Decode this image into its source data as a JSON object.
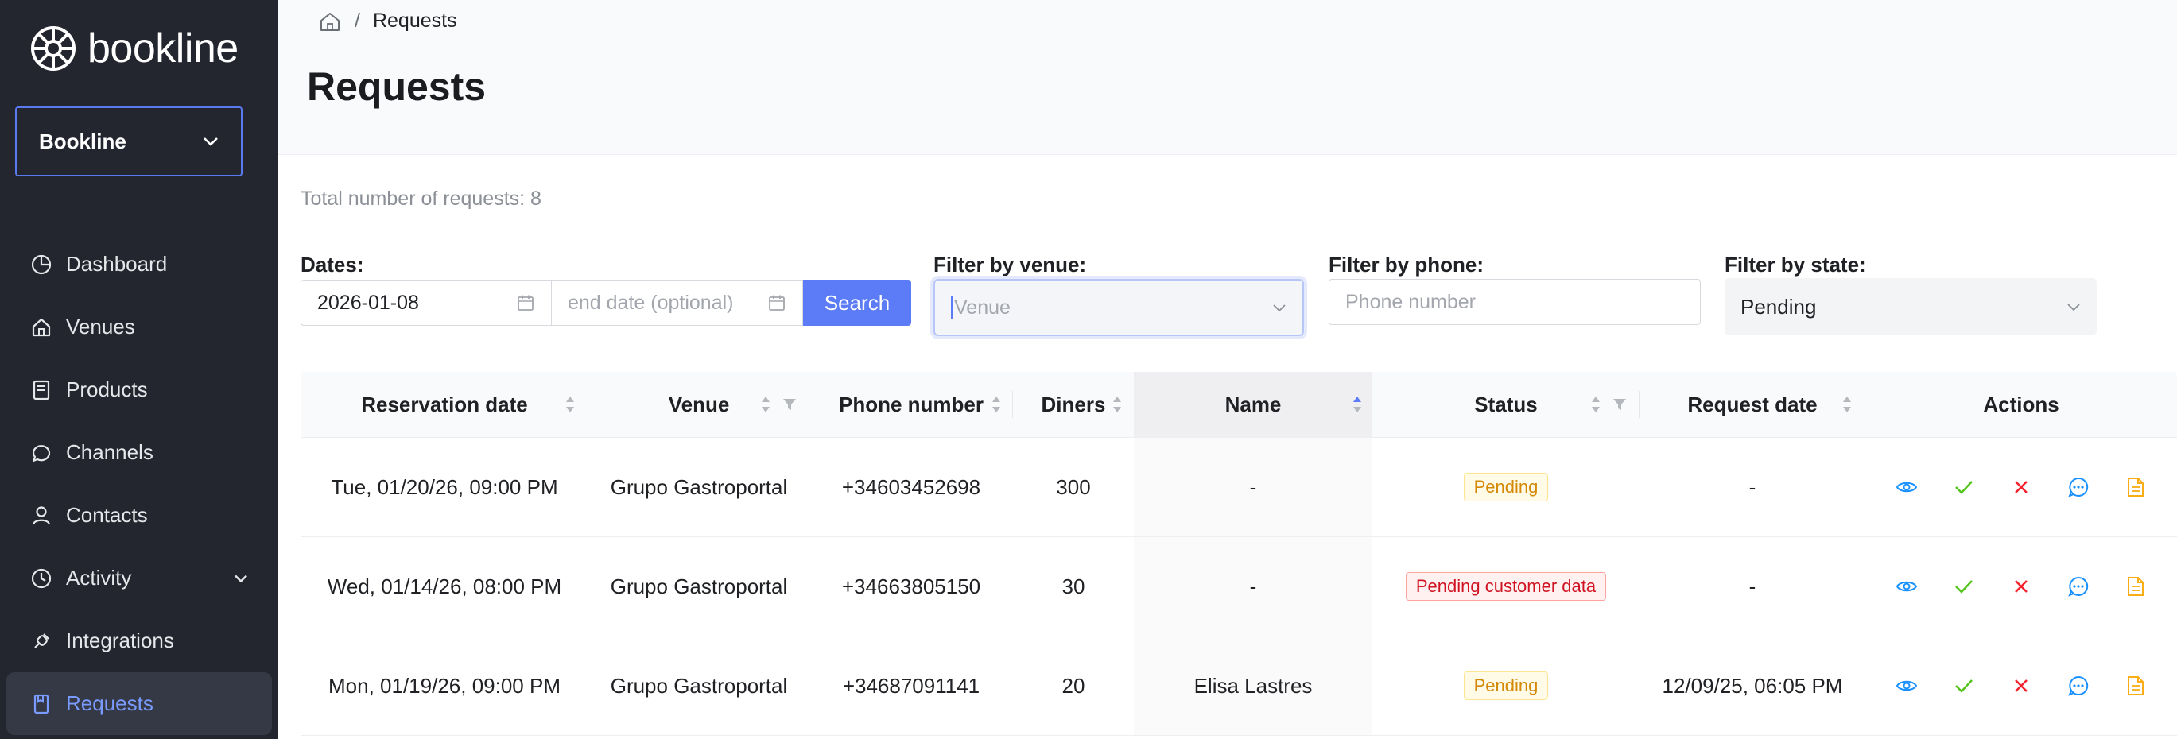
{
  "app": {
    "brand": "bookline",
    "workspace": "Bookline"
  },
  "sidebar": {
    "items": [
      {
        "label": "Dashboard",
        "icon": "pie-chart-icon"
      },
      {
        "label": "Venues",
        "icon": "home-icon"
      },
      {
        "label": "Products",
        "icon": "book-icon"
      },
      {
        "label": "Channels",
        "icon": "chat-icon"
      },
      {
        "label": "Contacts",
        "icon": "user-icon"
      },
      {
        "label": "Activity",
        "icon": "clock-icon"
      },
      {
        "label": "Integrations",
        "icon": "plug-icon"
      },
      {
        "label": "Requests",
        "icon": "bookmark-icon",
        "active": true
      }
    ]
  },
  "breadcrumb": {
    "current": "Requests",
    "sep": "/"
  },
  "page": {
    "title": "Requests",
    "total": "Total number of requests: 8"
  },
  "filters": {
    "dates_label": "Dates:",
    "start_date": "2026-01-08",
    "end_date_placeholder": "end date (optional)",
    "search_label": "Search",
    "venue_label": "Filter by venue:",
    "venue_placeholder": "Venue",
    "phone_label": "Filter by phone:",
    "phone_placeholder": "Phone number",
    "state_label": "Filter by state:",
    "state_value": "Pending"
  },
  "table": {
    "columns": [
      "Reservation date",
      "Venue",
      "Phone number",
      "Diners",
      "Name",
      "Status",
      "Request date",
      "Actions"
    ],
    "rows": [
      {
        "reservation": "Tue, 01/20/26, 09:00 PM",
        "venue": "Grupo Gastroportal",
        "phone": "+34603452698",
        "diners": "300",
        "name": "-",
        "status": "Pending",
        "status_kind": "pending",
        "request": "-"
      },
      {
        "reservation": "Wed, 01/14/26, 08:00 PM",
        "venue": "Grupo Gastroportal",
        "phone": "+34663805150",
        "diners": "30",
        "name": "-",
        "status": "Pending customer data",
        "status_kind": "customer",
        "request": "-"
      },
      {
        "reservation": "Mon, 01/19/26, 09:00 PM",
        "venue": "Grupo Gastroportal",
        "phone": "+34687091141",
        "diners": "20",
        "name": "Elisa Lastres",
        "status": "Pending",
        "status_kind": "pending",
        "request": "12/09/25, 06:05 PM"
      }
    ]
  },
  "colors": {
    "sidebar_bg": "#23262f",
    "accent": "#5b7cf6",
    "view": "#1890ff",
    "accept": "#52c41a",
    "reject": "#f5222d",
    "message": "#1890ff",
    "document": "#faad14"
  }
}
